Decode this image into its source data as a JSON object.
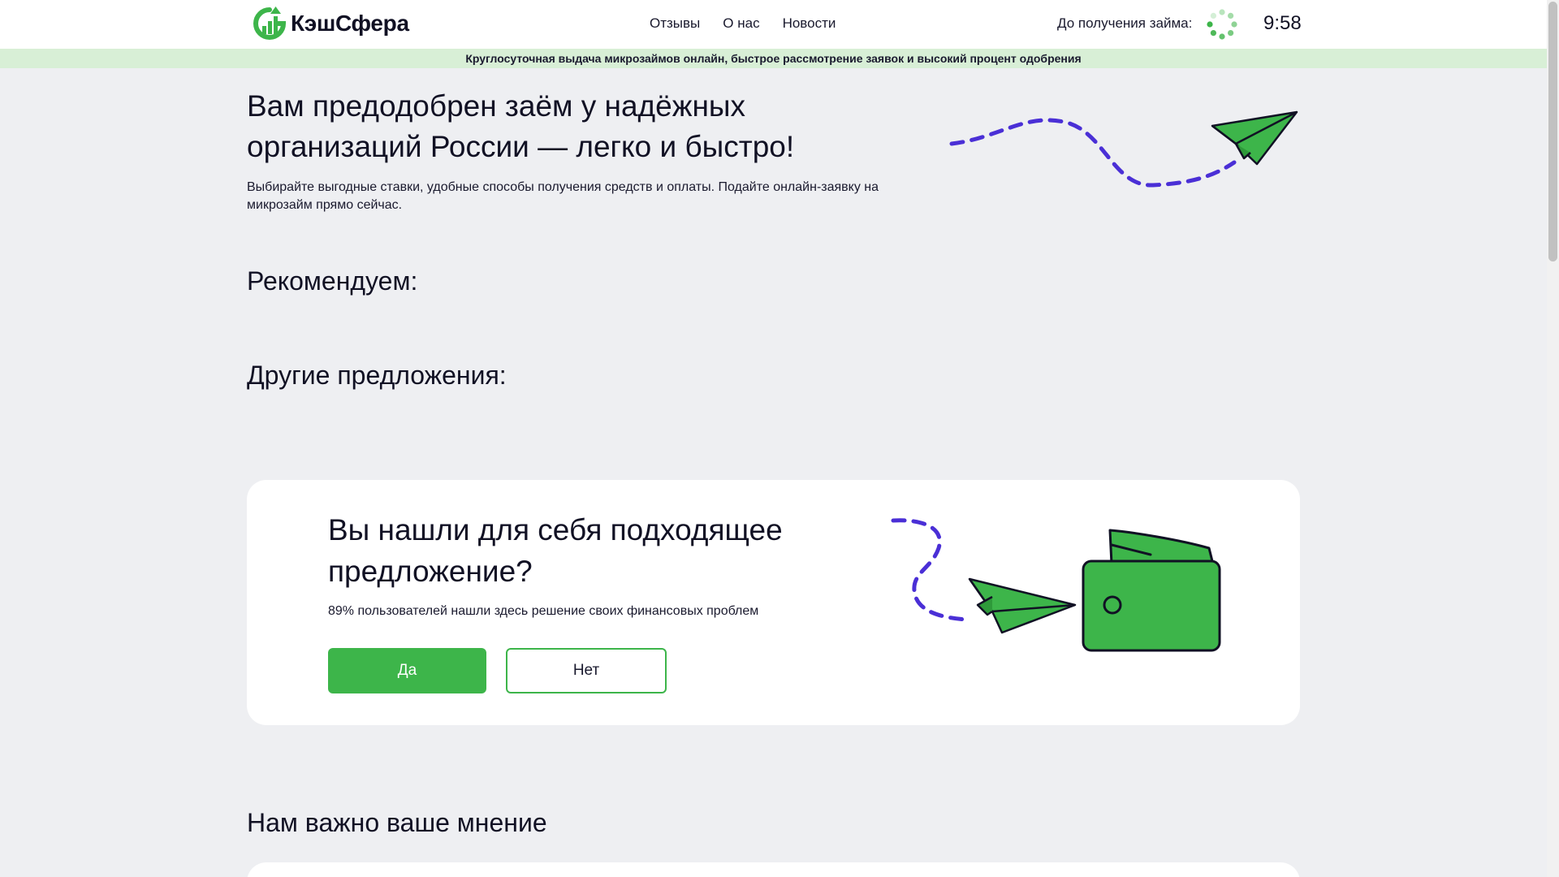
{
  "header": {
    "brand": "КэшСфера",
    "nav": [
      "Отзывы",
      "О нас",
      "Новости"
    ],
    "timer_label": "До получения займа:",
    "timer_value": "9:58"
  },
  "ticker": "Круглосуточная выдача микрозаймов онлайн, быстрое рассмотрение заявок и высокий процент одобрения",
  "hero": {
    "title": "Вам предодобрен заём у надёжных организаций России — легко и быстро!",
    "subtitle": "Выбирайте выгодные ставки, удобные способы получения средств и оплаты. Подайте онлайн-заявку на микрозайм прямо сейчас."
  },
  "sections": {
    "recommended": "Рекомендуем:",
    "other": "Другие предложения:",
    "opinion": "Нам важно ваше мнение"
  },
  "feedback_card": {
    "title": "Вы нашли для себя подходящее предложение?",
    "subtitle": "89% пользователей нашли здесь решение своих финансовых проблем",
    "yes_label": "Да",
    "no_label": "Нет"
  },
  "colors": {
    "accent": "#3db54a",
    "dash": "#4a2fd6",
    "ticker_bg": "#d8efd6",
    "page_bg": "#eeeff2"
  },
  "icons": [
    "logo-icon",
    "loading-spinner-icon",
    "paper-plane-icon",
    "wallet-icon"
  ]
}
